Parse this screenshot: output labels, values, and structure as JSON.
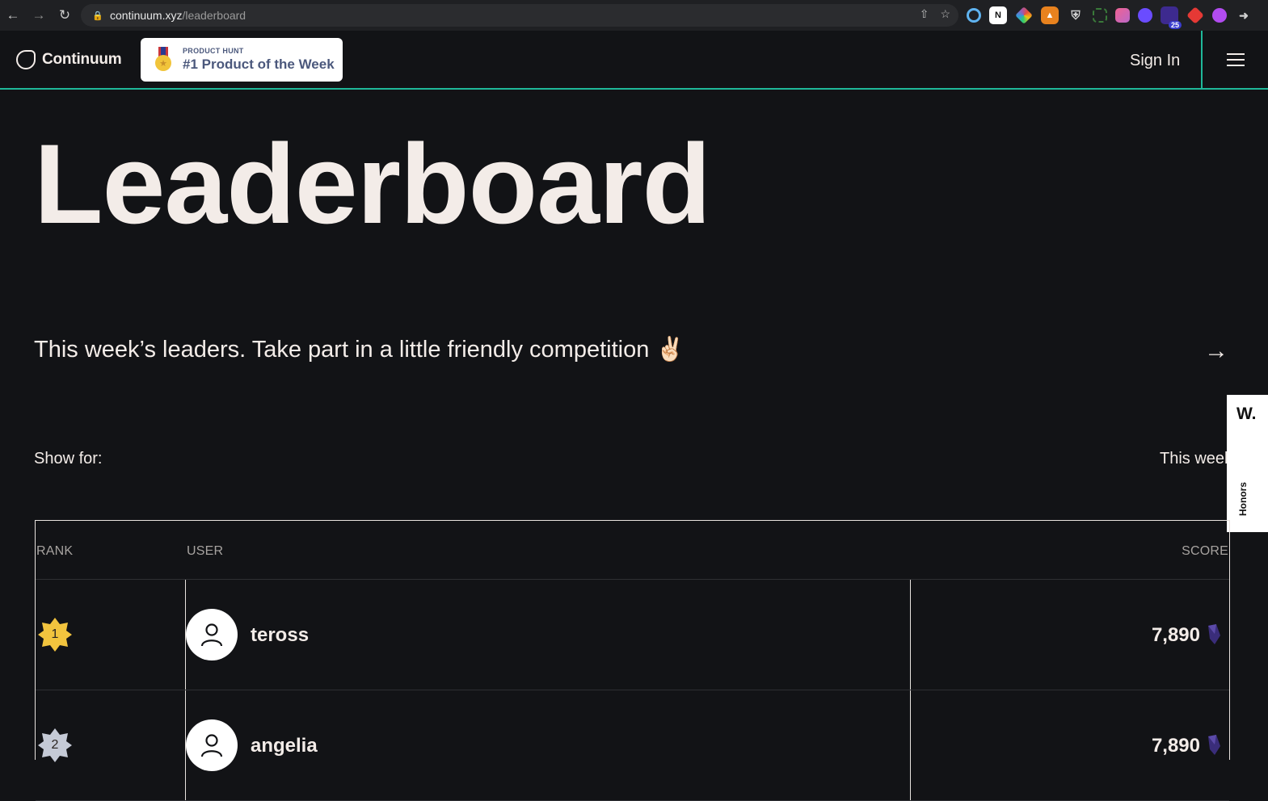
{
  "browser": {
    "url_host": "continuum.xyz",
    "url_path": "/leaderboard",
    "extension_badge": "25"
  },
  "header": {
    "logo_text": "Continuum",
    "ph_small": "PRODUCT HUNT",
    "ph_big": "#1 Product of the Week",
    "sign_in": "Sign In"
  },
  "hero": {
    "title": "Leaderboard",
    "subtitle": "This week’s leaders. Take part in a little friendly competition ✌🏻"
  },
  "filter": {
    "label": "Show for:",
    "value": "This week"
  },
  "honors": {
    "logo": "W.",
    "label": "Honors"
  },
  "table": {
    "headers": {
      "rank": "RANK",
      "user": "USER",
      "score": "SCORE"
    },
    "rows": [
      {
        "rank": "1",
        "user": "teross",
        "score": "7,890",
        "badge_color": "#f2c43e"
      },
      {
        "rank": "2",
        "user": "angelia",
        "score": "7,890",
        "badge_color": "#c5cad6"
      }
    ]
  },
  "colors": {
    "accent": "#1fb89a",
    "background": "#121316",
    "text": "#f3ece8",
    "gem": "#4a3a8c"
  }
}
